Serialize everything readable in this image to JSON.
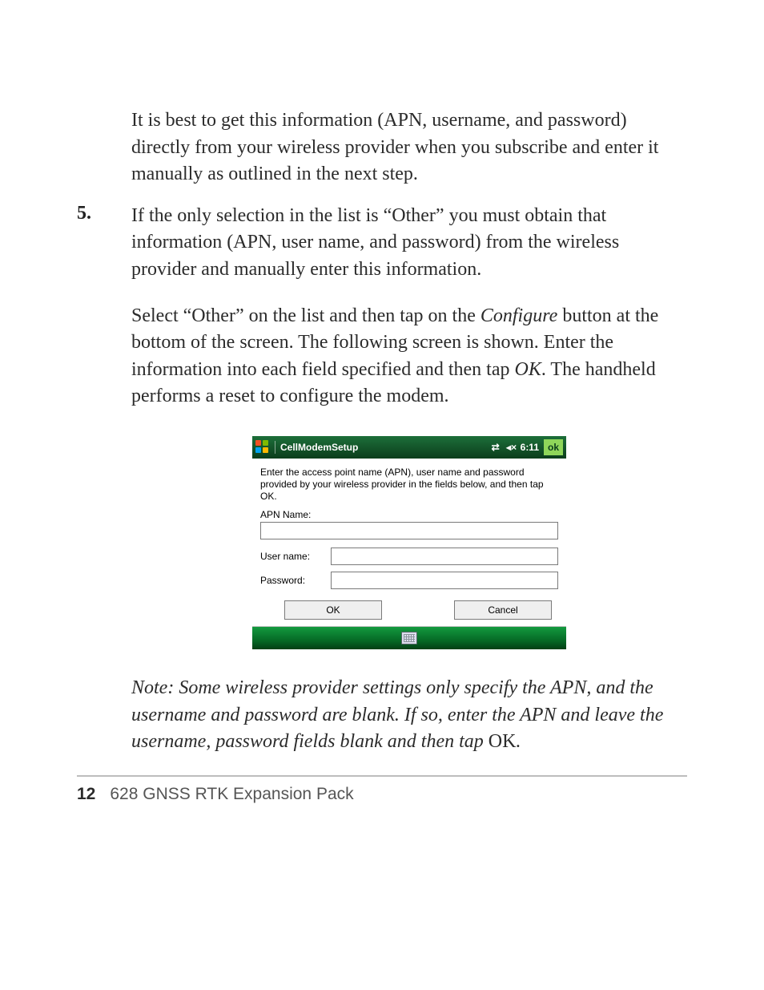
{
  "paragraphs": {
    "intro": "It is best to get this information (APN, username, and password) directly from your wireless provider when you subscribe and enter it manually as outlined in the next step.",
    "step_number": "5.",
    "step5_p1": "If the only selection in the list is “Other” you must obtain that information (APN, user name, and password) from the wireless provider and manually enter this information.",
    "step5_p2a": "Select “Other” on the list and then tap on the ",
    "step5_p2_configure": "Configure",
    "step5_p2b": " button at the bottom of the screen. The following screen is shown. Enter the information into each field specified and then tap ",
    "step5_p2_ok": "OK",
    "step5_p2c": ". The handheld performs a reset to configure the modem."
  },
  "screenshot": {
    "title": "CellModemSetup",
    "clock": "6:11",
    "ok_indicator": "ok",
    "connectivity_glyph": "⇄",
    "speaker_glyph": "◂×",
    "instruction": "Enter the access point name (APN), user name and password provided by your wireless provider in the fields below, and then tap OK.",
    "apn_label": "APN Name:",
    "apn_value": "",
    "username_label": "User name:",
    "username_value": "",
    "password_label": "Password:",
    "password_value": "",
    "btn_ok": "OK",
    "btn_cancel": "Cancel"
  },
  "note": {
    "prefix": "Note: Some wireless provider settings only specify the APN, and the username and password are blank. If so, enter the APN and leave the username, password  fields blank and then tap ",
    "ok": "OK",
    "suffix": "."
  },
  "footer": {
    "page_number": "12",
    "book_title": "628 GNSS RTK Expansion Pack"
  }
}
